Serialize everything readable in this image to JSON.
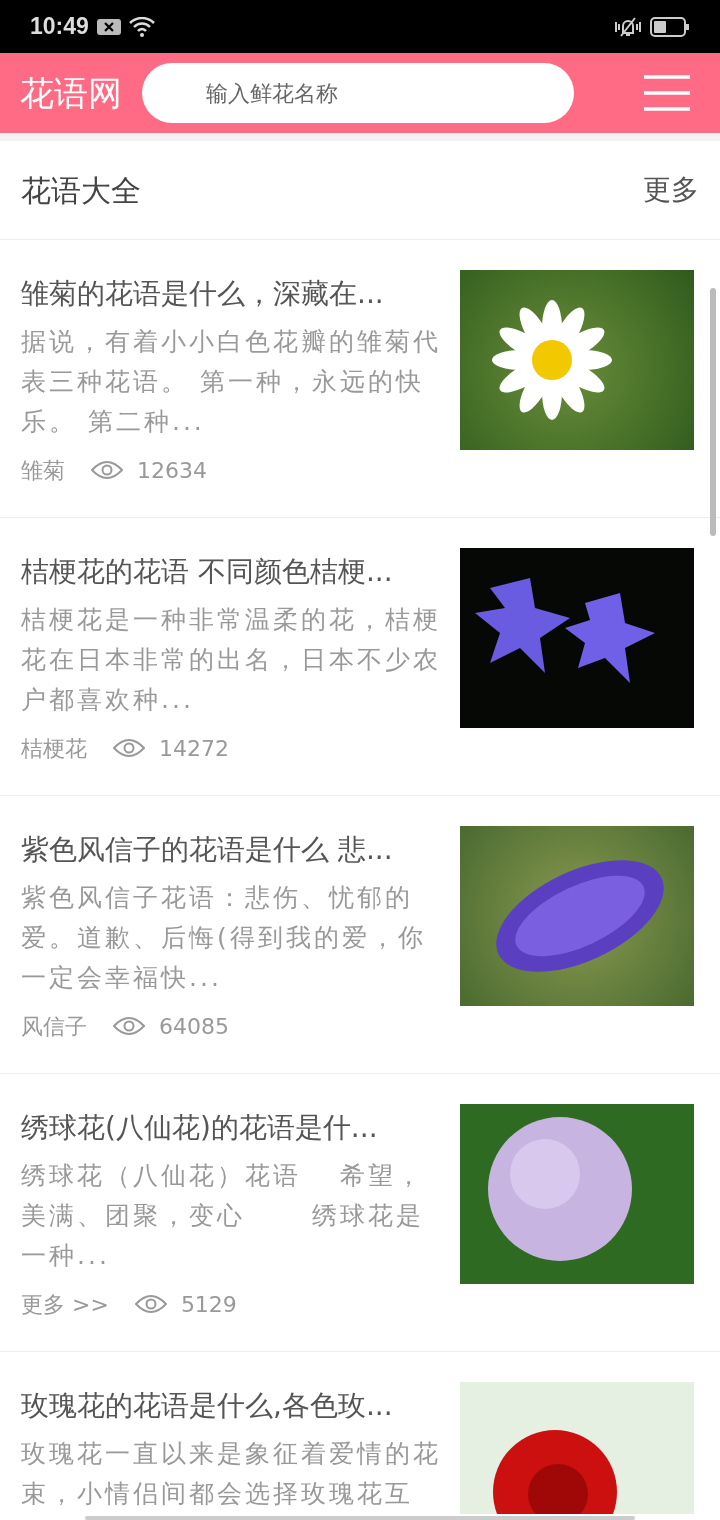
{
  "status_bar": {
    "time": "10:49"
  },
  "app_bar": {
    "logo": "花语网",
    "search": {
      "placeholder": "输入鲜花名称"
    }
  },
  "section": {
    "title": "花语大全",
    "more": "更多"
  },
  "articles": [
    {
      "title": "雏菊的花语是什么，深藏在...",
      "summary": "据说，有着小小白色花瓣的雏菊代表三种花语。 第一种，永远的快乐。 第二种...",
      "tag": "雏菊",
      "views": "12634",
      "kind": "daisy"
    },
    {
      "title": "桔梗花的花语 不同颜色桔梗...",
      "summary": "桔梗花是一种非常温柔的花，桔梗花在日本非常的出名，日本不少农户都喜欢种...",
      "tag": "桔梗花",
      "views": "14272",
      "kind": "bellflower"
    },
    {
      "title": "紫色风信子的花语是什么 悲...",
      "summary": "紫色风信子花语：悲伤、忧郁的爱。道歉、后悔(得到我的爱，你一定会幸福快...",
      "tag": "风信子",
      "views": "64085",
      "kind": "hyacinth"
    },
    {
      "title": "绣球花(八仙花)的花语是什...",
      "summary": "绣球花（八仙花）花语　 希望，美满、团聚，变心　　 绣球花是一种...",
      "tag": "更多 >>",
      "views": "5129",
      "kind": "hydrangea"
    },
    {
      "title": "玫瑰花的花语是什么,各色玫...",
      "summary": "玫瑰花一直以来是象征着爱情的花束，小情侣间都会选择玫瑰花互",
      "kind": "rose"
    }
  ]
}
